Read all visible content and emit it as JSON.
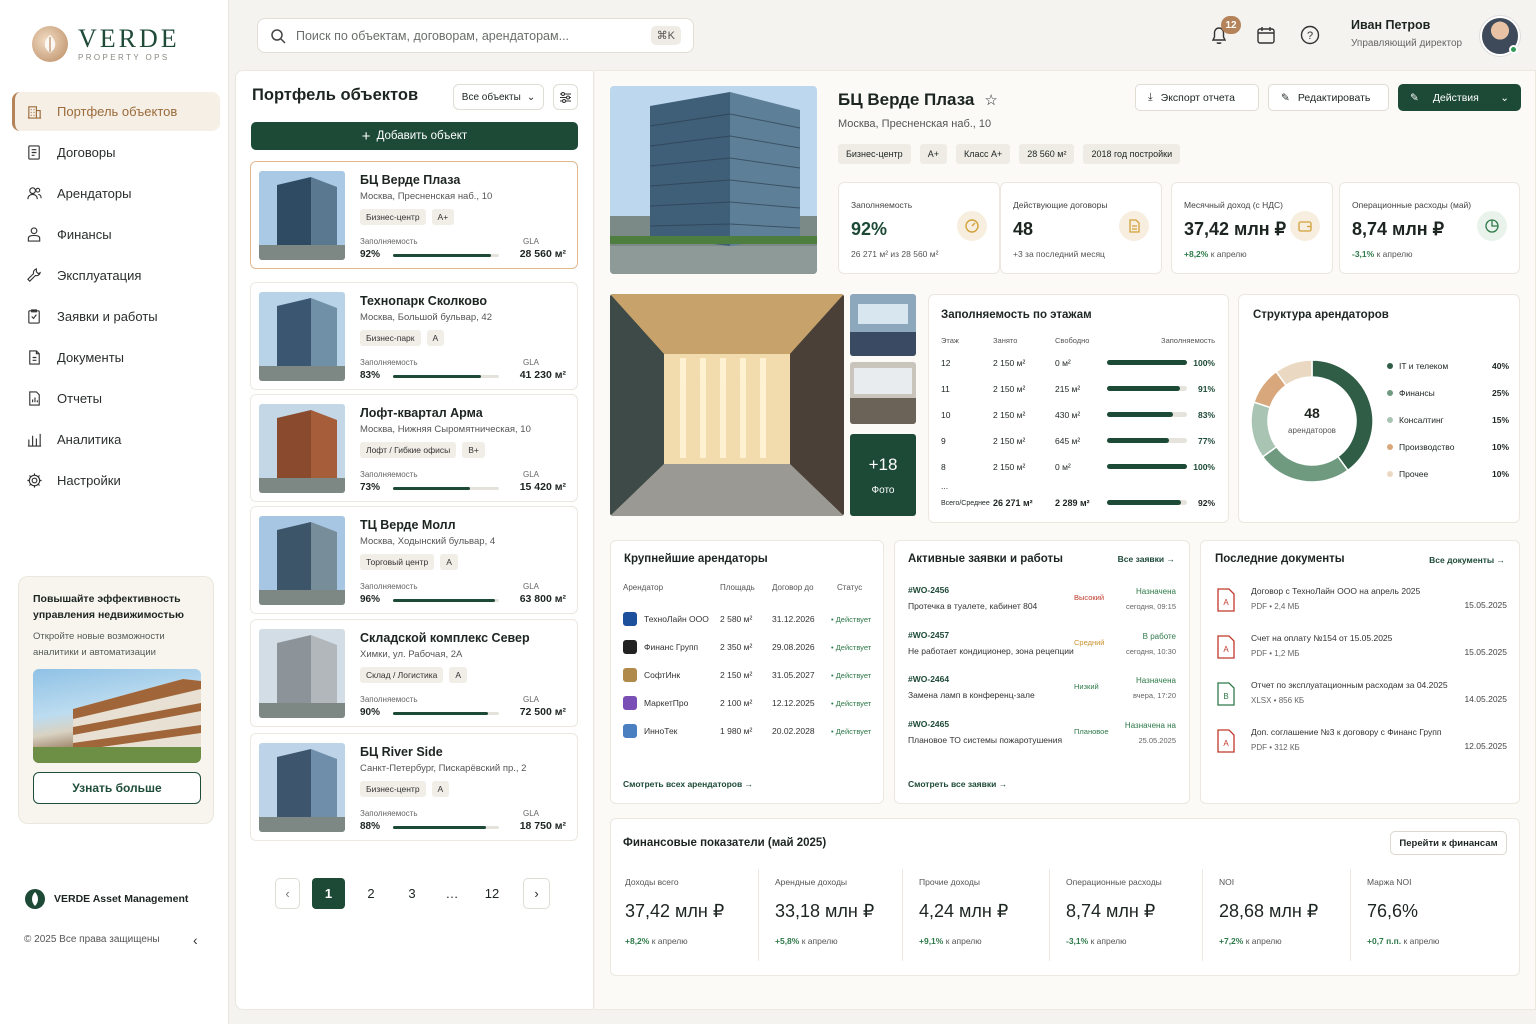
{
  "brand": {
    "name": "VERDE",
    "tagline": "PROPERTY OPS",
    "company": "VERDE Asset Management",
    "copyright": "© 2025 Все права защищены"
  },
  "nav": [
    {
      "label": "Портфель объектов",
      "icon": "building-icon",
      "active": true
    },
    {
      "label": "Договоры",
      "icon": "contract-icon"
    },
    {
      "label": "Арендаторы",
      "icon": "users-icon"
    },
    {
      "label": "Финансы",
      "icon": "wallet-icon"
    },
    {
      "label": "Эксплуатация",
      "icon": "wrench-icon"
    },
    {
      "label": "Заявки и работы",
      "icon": "clipboard-icon"
    },
    {
      "label": "Документы",
      "icon": "document-icon"
    },
    {
      "label": "Отчеты",
      "icon": "report-icon"
    },
    {
      "label": "Аналитика",
      "icon": "analytics-icon"
    },
    {
      "label": "Настройки",
      "icon": "gear-icon"
    }
  ],
  "promo": {
    "title": "Повышайте эффективность управления недвижимостью",
    "text": "Откройте новые возможности аналитики и автоматизации",
    "button": "Узнать больше"
  },
  "search": {
    "placeholder": "Поиск по объектам, договорам, арендаторам...",
    "shortcut": "⌘K"
  },
  "notifications": {
    "count": "12"
  },
  "user": {
    "name": "Иван Петров",
    "role": "Управляющий директор"
  },
  "list": {
    "title": "Портфель объектов",
    "filter": "Все объекты",
    "add": "Добавить объект",
    "occupancy_label": "Заполняемость",
    "gla_label": "GLA",
    "items": [
      {
        "name": "БЦ Верде Плаза",
        "address": "Москва, Пресненская наб., 10",
        "type": "Бизнес-центр",
        "class": "A+",
        "occupancy": "92%",
        "occ_value": 92,
        "gla": "28 560 м²"
      },
      {
        "name": "Технопарк Сколково",
        "address": "Москва, Большой бульвар, 42",
        "type": "Бизнес-парк",
        "class": "A",
        "occupancy": "83%",
        "occ_value": 83,
        "gla": "41 230 м²"
      },
      {
        "name": "Лофт-квартал Арма",
        "address": "Москва, Нижняя Сыромятническая, 10",
        "type": "Лофт / Гибкие офисы",
        "class": "B+",
        "occupancy": "73%",
        "occ_value": 73,
        "gla": "15 420 м²"
      },
      {
        "name": "ТЦ Верде Молл",
        "address": "Москва, Ходынский бульвар, 4",
        "type": "Торговый центр",
        "class": "A",
        "occupancy": "96%",
        "occ_value": 96,
        "gla": "63 800 м²"
      },
      {
        "name": "Складской комплекс Север",
        "address": "Химки, ул. Рабочая, 2А",
        "type": "Склад / Логистика",
        "class": "A",
        "occupancy": "90%",
        "occ_value": 90,
        "gla": "72 500 м²"
      },
      {
        "name": "БЦ River Side",
        "address": "Санкт-Петербург, Пискарёвский пр., 2",
        "type": "Бизнес-центр",
        "class": "A",
        "occupancy": "88%",
        "occ_value": 88,
        "gla": "18 750 м²"
      }
    ],
    "pages": [
      "1",
      "2",
      "3",
      "…",
      "12"
    ]
  },
  "object": {
    "title": "БЦ Верде Плаза",
    "address": "Москва, Пресненская наб., 10",
    "tags": [
      "Бизнес-центр",
      "A+",
      "Класс A+",
      "28 560 м²",
      "2018 год постройки"
    ],
    "buttons": {
      "export": "Экспорт отчета",
      "edit": "Редактировать",
      "actions": "Действия"
    }
  },
  "kpis": [
    {
      "label": "Заполняемость",
      "value": "92%",
      "sub": "26 271 м² из 28 560 м²",
      "icon": "gauge-icon"
    },
    {
      "label": "Действующие договоры",
      "value": "48",
      "sub": "+3 за последний месяц",
      "icon": "document-icon"
    },
    {
      "label": "Месячный доход (с НДС)",
      "value": "37,42 млн ₽",
      "delta": "+8,2%",
      "sub": "к апрелю",
      "icon": "wallet-icon"
    },
    {
      "label": "Операционные расходы (май)",
      "value": "8,74 млн ₽",
      "delta": "-3,1%",
      "sub": "к апрелю",
      "icon": "pie-icon"
    }
  ],
  "gallery": {
    "more": "+18",
    "more_label": "Фото"
  },
  "floors": {
    "title": "Заполняемость по этажам",
    "headers": [
      "Этаж",
      "Занято",
      "Свободно",
      "Заполняемость"
    ],
    "rows": [
      {
        "floor": "12",
        "occupied": "2 150 м²",
        "free": "0 м²",
        "pct": "100%",
        "value": 100
      },
      {
        "floor": "11",
        "occupied": "2 150 м²",
        "free": "215 м²",
        "pct": "91%",
        "value": 91
      },
      {
        "floor": "10",
        "occupied": "2 150 м²",
        "free": "430 м²",
        "pct": "83%",
        "value": 83
      },
      {
        "floor": "9",
        "occupied": "2 150 м²",
        "free": "645 м²",
        "pct": "77%",
        "value": 77
      },
      {
        "floor": "8",
        "occupied": "2 150 м²",
        "free": "0 м²",
        "pct": "100%",
        "value": 100
      }
    ],
    "ellipsis": "...",
    "total": {
      "label": "Всего/Среднее",
      "occupied": "26 271 м²",
      "free": "2 289 м²",
      "pct": "92%",
      "value": 92
    }
  },
  "structure": {
    "title": "Структура арендаторов",
    "center_value": "48",
    "center_label": "арендаторов",
    "items": [
      {
        "label": "IT и телеком",
        "pct": "40%",
        "value": 40,
        "color": "#2f5d46"
      },
      {
        "label": "Финансы",
        "pct": "25%",
        "value": 25,
        "color": "#6f9a80"
      },
      {
        "label": "Консалтинг",
        "pct": "15%",
        "value": 15,
        "color": "#a9c4b2"
      },
      {
        "label": "Производство",
        "pct": "10%",
        "value": 10,
        "color": "#d9a77c"
      },
      {
        "label": "Прочее",
        "pct": "10%",
        "value": 10,
        "color": "#ead8c3"
      }
    ]
  },
  "tenants": {
    "title": "Крупнейшие арендаторы",
    "headers": [
      "Арендатор",
      "Площадь",
      "Договор до",
      "Статус"
    ],
    "rows": [
      {
        "name": "ТехноЛайн ООО",
        "area": "2 580 м²",
        "until": "31.12.2026",
        "status": "Действует",
        "color": "#1c4f9c"
      },
      {
        "name": "Финанс Групп",
        "area": "2 350 м²",
        "until": "29.08.2026",
        "status": "Действует",
        "color": "#222"
      },
      {
        "name": "СофтИнк",
        "area": "2 150 м²",
        "until": "31.05.2027",
        "status": "Действует",
        "color": "#b08a4a"
      },
      {
        "name": "МаркетПро",
        "area": "2 100 м²",
        "until": "12.12.2025",
        "status": "Действует",
        "color": "#7a4fb5"
      },
      {
        "name": "ИнноТек",
        "area": "1 980 м²",
        "until": "20.02.2028",
        "status": "Действует",
        "color": "#4a7fc1"
      }
    ],
    "link": "Смотреть всех арендаторов"
  },
  "orders": {
    "title": "Активные заявки и работы",
    "all": "Все заявки",
    "rows": [
      {
        "id": "#WO-2456",
        "desc": "Протечка в туалете, кабинет 804",
        "priority": "Высокий",
        "pcolor": "#c0392b",
        "status": "Назначена",
        "time": "сегодня, 09:15"
      },
      {
        "id": "#WO-2457",
        "desc": "Не работает кондиционер, зона рецепции",
        "priority": "Средний",
        "pcolor": "#c8932f",
        "status": "В работе",
        "time": "сегодня, 10:30"
      },
      {
        "id": "#WO-2464",
        "desc": "Замена ламп в конференц-зале",
        "priority": "Низкий",
        "pcolor": "#2f7a4a",
        "status": "Назначена",
        "time": "вчера, 17:20"
      },
      {
        "id": "#WO-2465",
        "desc": "Плановое ТО системы пожаротушения",
        "priority": "Плановое",
        "pcolor": "#2f7a4a",
        "status": "Назначена на",
        "time": "25.05.2025"
      }
    ],
    "link": "Смотреть все заявки"
  },
  "docs": {
    "title": "Последние документы",
    "all": "Все документы",
    "rows": [
      {
        "name": "Договор с ТехноЛайн ООО на апрель 2025",
        "meta": "PDF  •  2,4 МБ",
        "date": "15.05.2025",
        "type": "pdf"
      },
      {
        "name": "Счет на оплату №154 от 15.05.2025",
        "meta": "PDF  •  1,2 МБ",
        "date": "15.05.2025",
        "type": "pdf"
      },
      {
        "name": "Отчет по эксплуатационным расходам за 04.2025",
        "meta": "XLSX  •  856 КБ",
        "date": "14.05.2025",
        "type": "xlsx"
      },
      {
        "name": "Доп. соглашение №3 к договору с Финанс Групп",
        "meta": "PDF  •  312 КБ",
        "date": "12.05.2025",
        "type": "pdf"
      }
    ]
  },
  "finance": {
    "title": "Финансовые показатели (май 2025)",
    "button": "Перейти к финансам",
    "items": [
      {
        "label": "Доходы всего",
        "value": "37,42 млн ₽",
        "delta": "+8,2%",
        "sub": "к апрелю"
      },
      {
        "label": "Арендные доходы",
        "value": "33,18 млн ₽",
        "delta": "+5,8%",
        "sub": "к апрелю"
      },
      {
        "label": "Прочие доходы",
        "value": "4,24 млн ₽",
        "delta": "+9,1%",
        "sub": "к апрелю"
      },
      {
        "label": "Операционные расходы",
        "value": "8,74 млн ₽",
        "delta": "-3,1%",
        "sub": "к апрелю"
      },
      {
        "label": "NOI",
        "value": "28,68 млн ₽",
        "delta": "+7,2%",
        "sub": "к апрелю"
      },
      {
        "label": "Маржа NOI",
        "value": "76,6%",
        "delta": "+0,7 п.п.",
        "sub": "к апрелю"
      }
    ]
  }
}
